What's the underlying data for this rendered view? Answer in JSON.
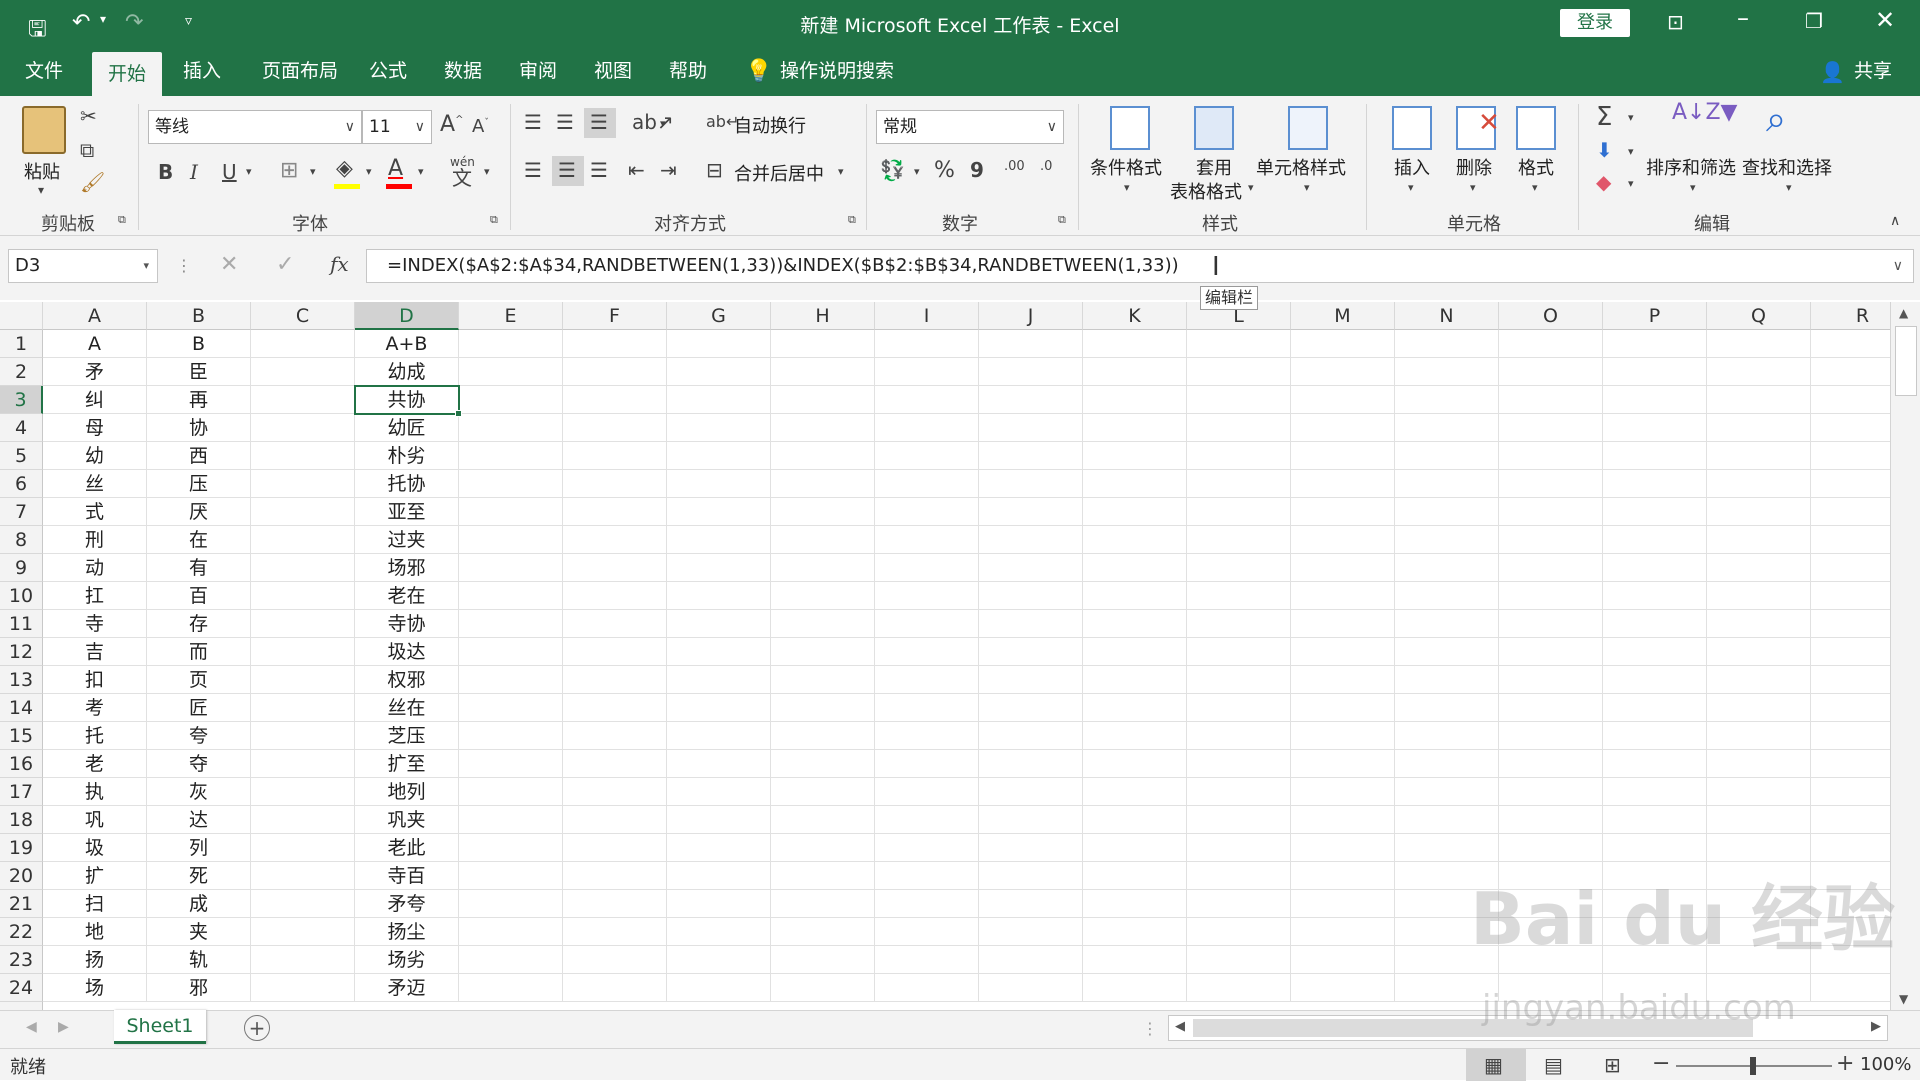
{
  "window": {
    "title": "新建 Microsoft Excel 工作表  -  Excel",
    "login_label": "登录"
  },
  "tabs": [
    {
      "label": "文件"
    },
    {
      "label": "开始"
    },
    {
      "label": "插入"
    },
    {
      "label": "页面布局"
    },
    {
      "label": "公式"
    },
    {
      "label": "数据"
    },
    {
      "label": "审阅"
    },
    {
      "label": "视图"
    },
    {
      "label": "帮助"
    }
  ],
  "tell_me": "操作说明搜索",
  "share_label": "共享",
  "ribbon": {
    "clipboard": {
      "paste": "粘贴",
      "group": "剪贴板"
    },
    "font": {
      "name": "等线",
      "size": "11",
      "bold": "B",
      "italic": "I",
      "underline": "U",
      "group": "字体",
      "phonetic": "wén"
    },
    "alignment": {
      "wrap": "自动换行",
      "merge": "合并后居中",
      "group": "对齐方式"
    },
    "number": {
      "format": "常规",
      "percent": "%",
      "comma": "9",
      "inc_decimal": ".00",
      "dec_decimal": ".0",
      "group": "数字"
    },
    "styles": {
      "conditional": "条件格式",
      "table_line1": "套用",
      "table_line2": "表格格式",
      "cell_styles": "单元格样式",
      "group": "样式"
    },
    "cells": {
      "insert": "插入",
      "delete": "删除",
      "format": "格式",
      "group": "单元格"
    },
    "editing": {
      "sort": "排序和筛选",
      "find": "查找和选择",
      "group": "编辑"
    }
  },
  "formula_bar": {
    "name_box": "D3",
    "formula": "=INDEX($A$2:$A$34,RANDBETWEEN(1,33))&INDEX($B$2:$B$34,RANDBETWEEN(1,33))",
    "tooltip": "编辑栏",
    "fx": "fx"
  },
  "grid": {
    "columns": [
      "A",
      "B",
      "C",
      "D",
      "E",
      "F",
      "G",
      "H",
      "I",
      "J",
      "K",
      "L",
      "M",
      "N",
      "O",
      "P",
      "Q",
      "R"
    ],
    "selected_column": "D",
    "selected_row": 3,
    "rows": [
      {
        "n": "1",
        "a": "A",
        "b": "B",
        "d": "A+B"
      },
      {
        "n": "2",
        "a": "矛",
        "b": "臣",
        "d": "幼成"
      },
      {
        "n": "3",
        "a": "纠",
        "b": "再",
        "d": "共协"
      },
      {
        "n": "4",
        "a": "母",
        "b": "协",
        "d": "幼匠"
      },
      {
        "n": "5",
        "a": "幼",
        "b": "西",
        "d": "朴劣"
      },
      {
        "n": "6",
        "a": "丝",
        "b": "压",
        "d": "托协"
      },
      {
        "n": "7",
        "a": "式",
        "b": "厌",
        "d": "亚至"
      },
      {
        "n": "8",
        "a": "刑",
        "b": "在",
        "d": "过夹"
      },
      {
        "n": "9",
        "a": "动",
        "b": "有",
        "d": "场邪"
      },
      {
        "n": "10",
        "a": "扛",
        "b": "百",
        "d": "老在"
      },
      {
        "n": "11",
        "a": "寺",
        "b": "存",
        "d": "寺协"
      },
      {
        "n": "12",
        "a": "吉",
        "b": "而",
        "d": "圾达"
      },
      {
        "n": "13",
        "a": "扣",
        "b": "页",
        "d": "权邪"
      },
      {
        "n": "14",
        "a": "考",
        "b": "匠",
        "d": "丝在"
      },
      {
        "n": "15",
        "a": "托",
        "b": "夸",
        "d": "芝压"
      },
      {
        "n": "16",
        "a": "老",
        "b": "夺",
        "d": "扩至"
      },
      {
        "n": "17",
        "a": "执",
        "b": "灰",
        "d": "地列"
      },
      {
        "n": "18",
        "a": "巩",
        "b": "达",
        "d": "巩夹"
      },
      {
        "n": "19",
        "a": "圾",
        "b": "列",
        "d": "老此"
      },
      {
        "n": "20",
        "a": "扩",
        "b": "死",
        "d": "寺百"
      },
      {
        "n": "21",
        "a": "扫",
        "b": "成",
        "d": "矛夸"
      },
      {
        "n": "22",
        "a": "地",
        "b": "夹",
        "d": "扬尘"
      },
      {
        "n": "23",
        "a": "扬",
        "b": "轨",
        "d": "场劣"
      },
      {
        "n": "24",
        "a": "场",
        "b": "邪",
        "d": "矛迈"
      }
    ]
  },
  "sheet_tab": "Sheet1",
  "status": {
    "ready": "就绪",
    "zoom": "100%"
  },
  "watermark": {
    "line1": "Bai du 经验",
    "line2": "jingyan.baidu.com"
  }
}
